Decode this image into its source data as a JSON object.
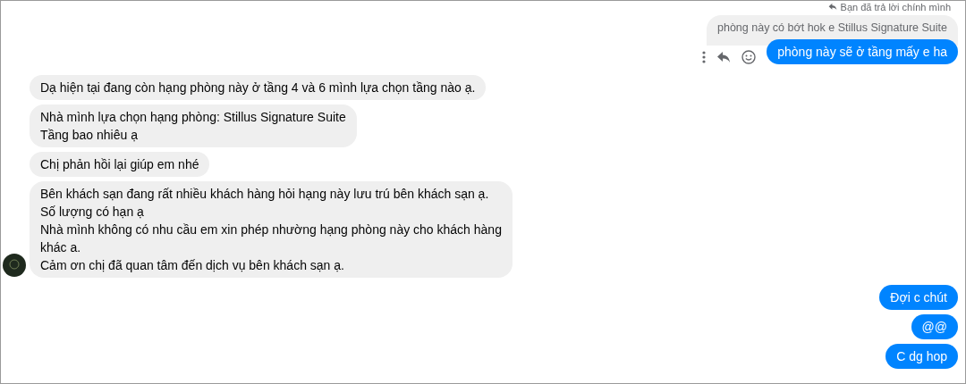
{
  "reply_note": "Bạn đã trả lời chính mình",
  "quoted_message": "phòng này có bớt hok e Stillus Signature Suite",
  "messages": [
    {
      "kind": "sent",
      "text": "phòng này sẽ ở tầng mấy e ha",
      "actions": true
    },
    {
      "kind": "received",
      "text": "Dạ hiện tại đang còn hạng phòng này ở tầng 4 và 6 mình lựa chọn tầng nào ạ."
    },
    {
      "kind": "received",
      "text": "Nhà mình lựa chọn hạng phòng: Stillus Signature Suite\nTầng bao nhiêu ạ"
    },
    {
      "kind": "received",
      "text": "Chị phản hồi lại giúp em nhé"
    },
    {
      "kind": "received",
      "text": "Bên khách sạn đang rất nhiều khách hàng hỏi hạng này lưu trú bên khách sạn ạ.\nSố lượng có hạn ạ\nNhà mình không có nhu cầu em xin phép nhường hạng phòng này cho khách hàng\nkhác a.\nCảm ơn chị đã quan tâm đến dịch vụ bên khách sạn ạ.",
      "avatar": true
    },
    {
      "kind": "sent",
      "text": "Đợi c chút"
    },
    {
      "kind": "sent",
      "text": "@@"
    },
    {
      "kind": "sent",
      "text": "C dg hop"
    }
  ]
}
